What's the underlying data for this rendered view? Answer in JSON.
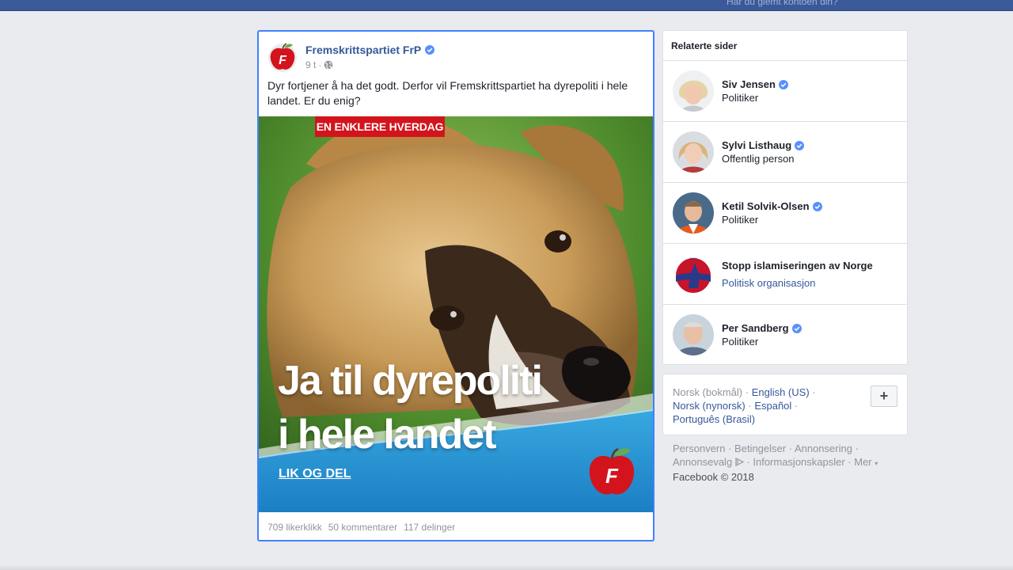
{
  "topbar": {
    "forgot_account": "Har du glemt kontoen din?"
  },
  "post": {
    "page_name": "Fremskrittspartiet FrP",
    "time": "9 t",
    "separator": "·",
    "text": "Dyr fortjener å ha det godt. Derfor vil Fremskrittspartiet ha dyrepoliti i hele landet. Er du enig?",
    "image": {
      "banner": "EN ENKLERE HVERDAG",
      "headline_line1": "Ja til dyrepoliti",
      "headline_line2": "i hele landet",
      "cta": "LIK OG DEL"
    },
    "stats": {
      "likes": "709 likerklikk",
      "comments": "50 kommentarer",
      "shares": "117 delinger"
    }
  },
  "related": {
    "title": "Relaterte sider",
    "items": [
      {
        "name": "Siv Jensen",
        "sub": "Politiker",
        "verified": true
      },
      {
        "name": "Sylvi Listhaug",
        "sub": "Offentlig person",
        "verified": true
      },
      {
        "name": "Ketil Solvik-Olsen",
        "sub": "Politiker",
        "verified": true
      },
      {
        "name": "Stopp islamiseringen av Norge",
        "sub": "Politisk organisasjon",
        "verified": false
      },
      {
        "name": "Per Sandberg",
        "sub": "Politiker",
        "verified": true
      }
    ]
  },
  "languages": {
    "current": "Norsk (bokmål)",
    "english": "English (US)",
    "nynorsk": "Norsk (nynorsk)",
    "spanish": "Español",
    "portuguese": "Português (Brasil)",
    "plus": "+"
  },
  "footer": {
    "privacy": "Personvern",
    "terms": "Betingelser",
    "advertising": "Annonsering",
    "ad_choices": "Annonsevalg",
    "cookies": "Informasjonskapsler",
    "more": "Mer",
    "copyright": "Facebook © 2018"
  },
  "colors": {
    "brand": "#3b5998",
    "link": "#365899",
    "accent_border": "#4080ff",
    "frp_red": "#d3141c"
  }
}
